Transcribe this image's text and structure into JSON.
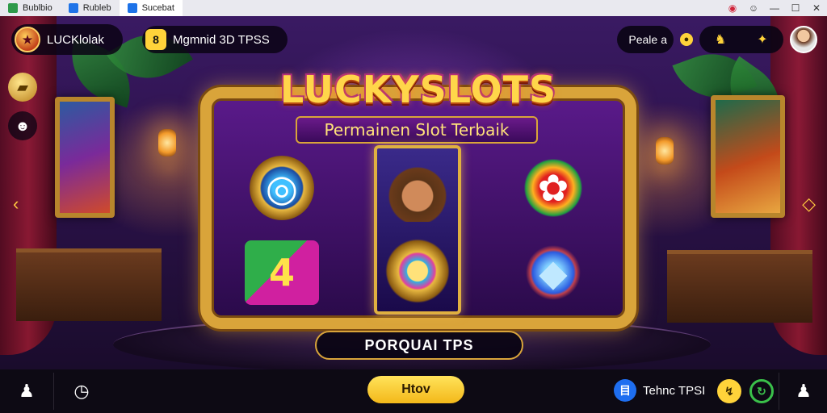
{
  "titlebar": {
    "tabs": [
      {
        "label": "Bublbio"
      },
      {
        "label": "Rubleb"
      },
      {
        "label": "Sucebat"
      }
    ],
    "controls": [
      "◉",
      "☺",
      "—",
      "☐",
      "✕"
    ]
  },
  "topbar": {
    "brand": "LUCKlolak",
    "info_number": "8",
    "info_text": "Mgmnid 3D TPSS",
    "profile_label": "Peale",
    "profile_suffix": "a",
    "coin_symbol": "●"
  },
  "game": {
    "title": "LUCKYSLOTS",
    "subtitle": "Permainen Slot Terbaik",
    "promo_text": "PORQUAI TPS",
    "reels": [
      {
        "top": "swirl",
        "bottom": "four"
      },
      {
        "top": "cowboy",
        "bottom": "coin"
      },
      {
        "top": "flower",
        "bottom": "gem"
      }
    ]
  },
  "bottombar": {
    "play_label": "Htov",
    "bonus_icon_text": "目",
    "bonus_text": "Tehnc  TPSI"
  },
  "icons": {
    "brand": "slot-logo-icon",
    "gold_bar": "gold-bar-icon",
    "group": "group-icon",
    "left_arrow": "chevron-left-icon",
    "right_arrow": "diamond-right-icon",
    "fox": "fox-icon",
    "lightning": "lightning-icon",
    "person_left": "person-icon",
    "clock": "clock-icon",
    "yellow_circle": "lightning-circle-icon",
    "green_circle": "refresh-circle-icon",
    "person_right": "person-icon"
  },
  "colors": {
    "accent_gold": "#d9a43a",
    "play_button": "#ffd33a",
    "bonus_blue": "#1e6ef0",
    "refresh_green": "#3ac04a"
  }
}
